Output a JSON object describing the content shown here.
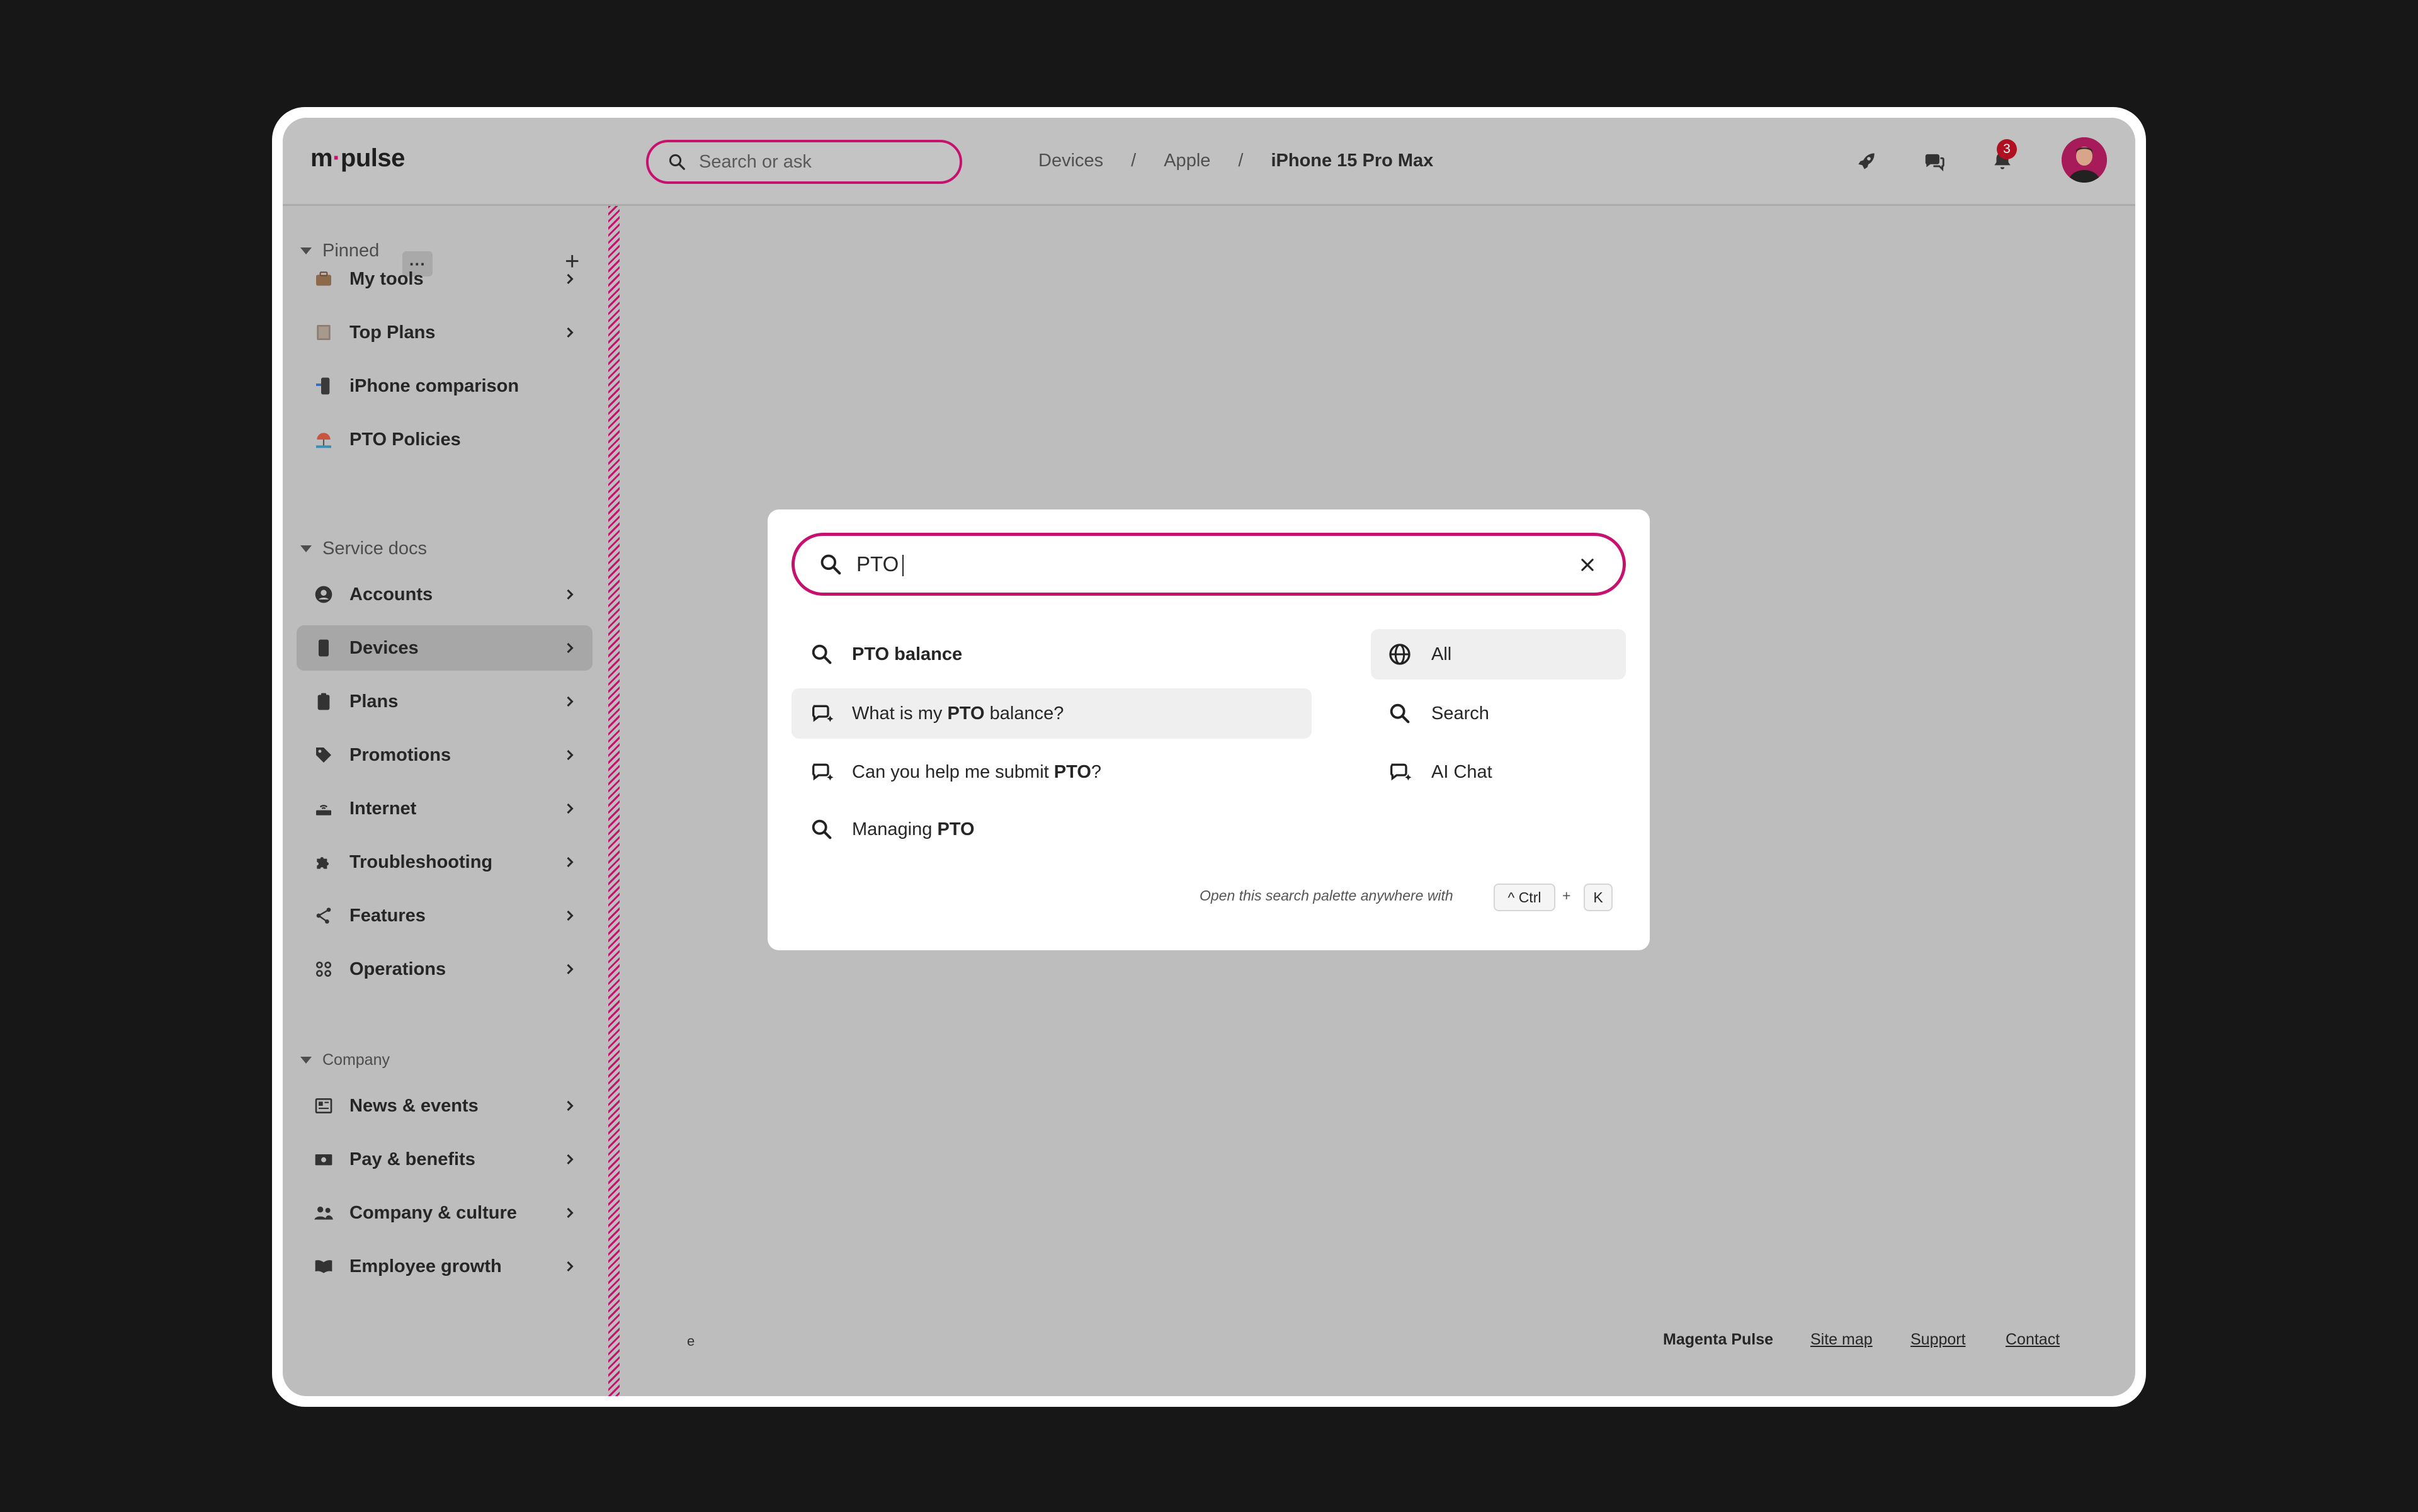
{
  "app": {
    "logo_m": "m",
    "logo_dot": "·",
    "logo_rest": "pulse"
  },
  "header": {
    "search_placeholder": "Search or ask",
    "breadcrumbs": [
      "Devices",
      "Apple",
      "iPhone 15 Pro Max"
    ],
    "separator": "/",
    "notification_count": "3"
  },
  "sidebar": {
    "sections": [
      {
        "title": "Pinned",
        "more_label": "···",
        "add_label": "+"
      },
      {
        "title": "Service docs"
      },
      {
        "title": "Company"
      }
    ],
    "pinned": [
      {
        "label": "My tools",
        "icon": "toolbox-icon"
      },
      {
        "label": "Top Plans",
        "icon": "plan-card-icon"
      },
      {
        "label": "iPhone comparison",
        "icon": "phone-icon"
      },
      {
        "label": "PTO Policies",
        "icon": "beach-icon"
      }
    ],
    "service_docs": [
      {
        "label": "Accounts",
        "icon": "user-circle-icon"
      },
      {
        "label": "Devices",
        "icon": "device-icon",
        "active": true
      },
      {
        "label": "Plans",
        "icon": "clipboard-icon"
      },
      {
        "label": "Promotions",
        "icon": "tag-icon"
      },
      {
        "label": "Internet",
        "icon": "router-icon"
      },
      {
        "label": "Troubleshooting",
        "icon": "puzzle-icon"
      },
      {
        "label": "Features",
        "icon": "share-icon"
      },
      {
        "label": "Operations",
        "icon": "operations-icon"
      }
    ],
    "company": [
      {
        "label": "News & events",
        "icon": "newspaper-icon"
      },
      {
        "label": "Pay & benefits",
        "icon": "money-icon"
      },
      {
        "label": "Company & culture",
        "icon": "people-icon"
      },
      {
        "label": "Employee growth",
        "icon": "book-icon"
      }
    ]
  },
  "footer": {
    "note": "e",
    "brand": "Magenta Pulse",
    "links": [
      "Site map",
      "Support",
      "Contact"
    ]
  },
  "palette": {
    "query": "PTO",
    "suggestions": [
      {
        "pre": "",
        "bold": "PTO balance",
        "post": "",
        "type": "search"
      },
      {
        "pre": "What is my ",
        "bold": "PTO",
        "post": " balance?",
        "type": "ai-chat"
      },
      {
        "pre": "Can you help me submit ",
        "bold": "PTO",
        "post": "?",
        "type": "ai-chat"
      },
      {
        "pre": "Managing ",
        "bold": "PTO",
        "post": "",
        "type": "search"
      }
    ],
    "filters": [
      "All",
      "Search",
      "AI Chat"
    ],
    "hint": "Open this search palette anywhere with",
    "shortcut": {
      "key1": "^ Ctrl",
      "plus": "+",
      "key2": "K"
    }
  },
  "colors": {
    "accent": "#c7116f",
    "badge": "#b01020"
  }
}
